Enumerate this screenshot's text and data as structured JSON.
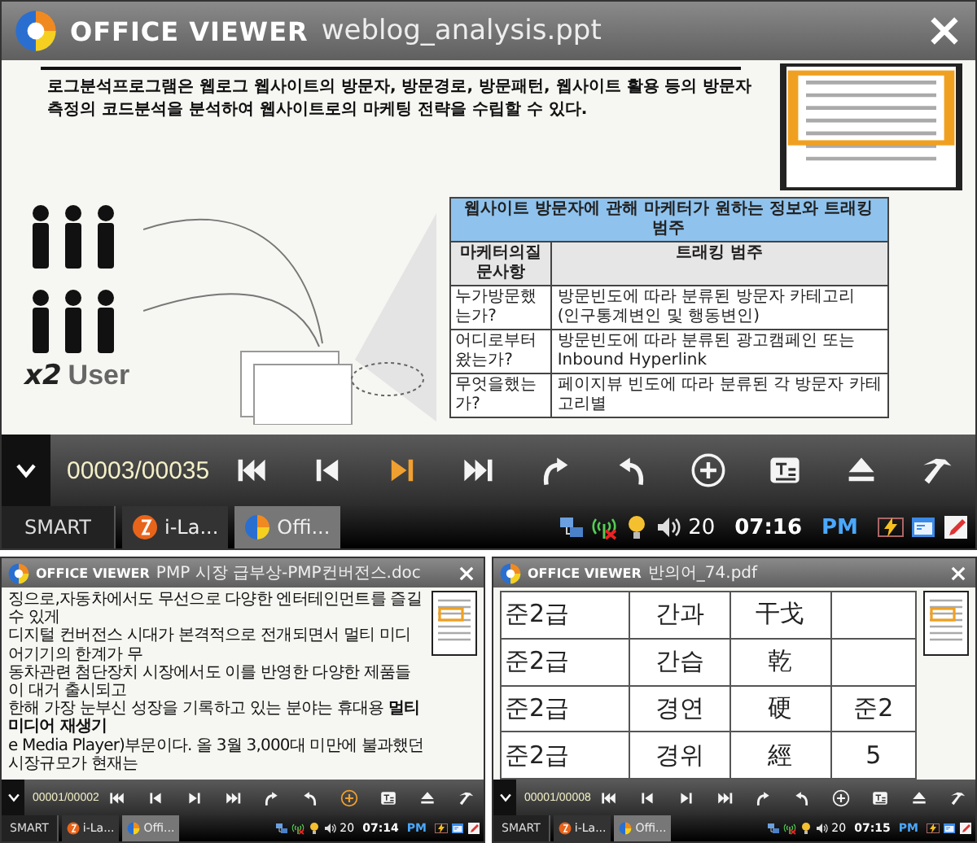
{
  "viewers": [
    {
      "kind": "slide",
      "app_name": "OFFICE VIEWER",
      "file_name": "weblog_analysis.ppt",
      "slide": {
        "body": "로그분석프로그램은 웹로그 웹사이트의 방문자, 방문경로, 방문패턴, 웹사이트 활용 등의 방문자 측정의 코드분석을 분석하여 웹사이트로의 마케팅 전략을 수립할 수 있다.",
        "figure": {
          "multiplier": "x2",
          "label": "User"
        },
        "table": {
          "title": "웹사이트 방문자에 관해 마케터가 원하는 정보와 트래킹 범주",
          "columns": [
            "마케터의질문사항",
            "트래킹 범주"
          ],
          "rows": [
            [
              "누가방문했는가?",
              "방문빈도에 따라 분류된 방문자 카테고리 (인구통계변인 및 행동변인)"
            ],
            [
              "어디로부터왔는가?",
              "방문빈도에 따라 분류된 광고캠페인 또는 Inbound Hyperlink"
            ],
            [
              "무엇을했는가?",
              "페이지뷰 빈도에 따라 분류된 각 방문자 카테고리별"
            ]
          ]
        }
      },
      "page_counter": "00003/00035",
      "toolbar": [
        {
          "kind": "first",
          "selected": false
        },
        {
          "kind": "prev",
          "selected": false
        },
        {
          "kind": "next",
          "selected": true
        },
        {
          "kind": "last",
          "selected": false
        },
        {
          "kind": "rotate_cw",
          "selected": false
        },
        {
          "kind": "rotate_ccw",
          "selected": false
        },
        {
          "kind": "zoom",
          "selected": false
        },
        {
          "kind": "text",
          "selected": false
        },
        {
          "kind": "eject",
          "selected": false
        },
        {
          "kind": "tool",
          "selected": false
        }
      ],
      "taskbar": {
        "start": "SMART",
        "tasks": [
          {
            "label": "i-La...",
            "selected": false
          },
          {
            "label": "Offi...",
            "selected": true
          }
        ],
        "volume": "20",
        "time": "07:16",
        "meridiem": "PM"
      }
    },
    {
      "kind": "document",
      "app_name": "OFFICE VIEWER",
      "file_name": "PMP 시장 급부상-PMP컨버전스.doc",
      "paragraphs": [
        "징으로,자동차에서도 무선으로 다양한 엔터테인먼트를 즐길 수 있게",
        "디지털 컨버전스 시대가 본격적으로 전개되면서 멀티 미디어기기의 한계가 무",
        "동차관련 첨단장치 시장에서도 이를 반영한 다양한 제품들이 대거 출시되고",
        "한해 가장 눈부신 성장을 기록하고 있는 분야는 휴대용 **멀티미디어 재생기**",
        "e Media Player)부문이다. 올 3월 3,000대 미만에 불과했던 시장규모가 현재는"
      ],
      "page_counter": "00001/00002",
      "toolbar": [
        {
          "kind": "first",
          "selected": false
        },
        {
          "kind": "prev",
          "selected": false
        },
        {
          "kind": "next",
          "selected": false
        },
        {
          "kind": "last",
          "selected": false
        },
        {
          "kind": "rotate_cw",
          "selected": false
        },
        {
          "kind": "rotate_ccw",
          "selected": false
        },
        {
          "kind": "zoom",
          "selected": true
        },
        {
          "kind": "text",
          "selected": false
        },
        {
          "kind": "eject",
          "selected": false
        },
        {
          "kind": "tool",
          "selected": false
        }
      ],
      "taskbar": {
        "start": "SMART",
        "tasks": [
          {
            "label": "i-La...",
            "selected": false
          },
          {
            "label": "Offi...",
            "selected": true
          }
        ],
        "volume": "20",
        "time": "07:14",
        "meridiem": "PM"
      }
    },
    {
      "kind": "table",
      "app_name": "OFFICE VIEWER",
      "file_name": "반의어_74.pdf",
      "rows": [
        [
          "준2급",
          "간과",
          "干戈",
          ""
        ],
        [
          "준2급",
          "간습",
          "乾",
          ""
        ],
        [
          "준2급",
          "경연",
          "硬",
          "준2"
        ],
        [
          "준2급",
          "경위",
          "經",
          "5"
        ]
      ],
      "page_counter": "00001/00008",
      "toolbar": [
        {
          "kind": "first",
          "selected": false
        },
        {
          "kind": "prev",
          "selected": false
        },
        {
          "kind": "next",
          "selected": false
        },
        {
          "kind": "last",
          "selected": false
        },
        {
          "kind": "rotate_cw",
          "selected": false
        },
        {
          "kind": "rotate_ccw",
          "selected": false
        },
        {
          "kind": "zoom",
          "selected": false
        },
        {
          "kind": "text",
          "selected": false
        },
        {
          "kind": "eject",
          "selected": false
        },
        {
          "kind": "tool",
          "selected": false
        }
      ],
      "taskbar": {
        "start": "SMART",
        "tasks": [
          {
            "label": "i-La...",
            "selected": false
          },
          {
            "label": "Offi...",
            "selected": true
          }
        ],
        "volume": "20",
        "time": "07:15",
        "meridiem": "PM"
      }
    }
  ]
}
